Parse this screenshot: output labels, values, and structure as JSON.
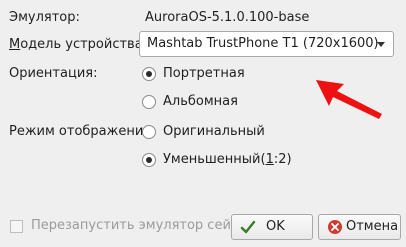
{
  "emulator": {
    "label": "Эмулятор:",
    "value": "AuroraOS-5.1.0.100-base"
  },
  "device_model": {
    "label_prefix": "",
    "label_underlined": "М",
    "label_rest": "одель устройства:",
    "selected": "Mashtab TrustPhone T1 (720x1600)"
  },
  "orientation": {
    "label": "Ориентация:",
    "options": [
      {
        "label": "Портретная",
        "checked": true
      },
      {
        "label": "Альбомная",
        "checked": false
      }
    ]
  },
  "display_mode": {
    "label": "Режим отображения:",
    "options": [
      {
        "label": "Оригинальный",
        "checked": false
      },
      {
        "label_prefix": "Уменьшенный(",
        "label_underlined": "1",
        "label_rest": ":2)",
        "checked": true
      }
    ]
  },
  "restart_checkbox": {
    "label": "Перезапустить эмулятор сейчас",
    "checked": false,
    "enabled": false
  },
  "buttons": {
    "ok": "OK",
    "cancel": "Отмена"
  },
  "annotation": {
    "arrow_color": "#ee1111"
  }
}
